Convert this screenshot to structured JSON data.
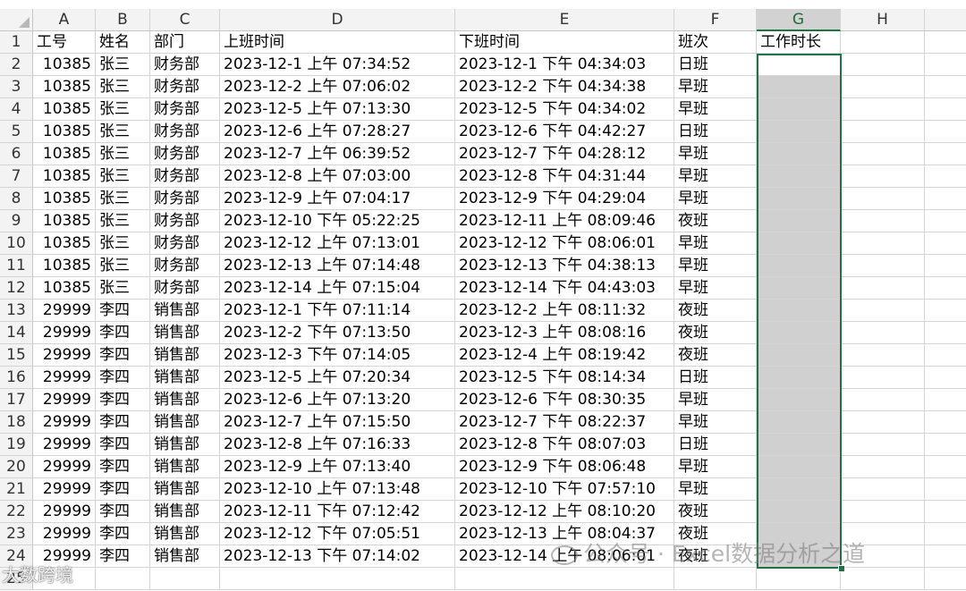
{
  "columns": [
    "A",
    "B",
    "C",
    "D",
    "E",
    "F",
    "G",
    "H"
  ],
  "selected_column": "G",
  "header_row": {
    "row_number": "1",
    "cells": [
      "工号",
      "姓名",
      "部门",
      "上班时间",
      "下班时间",
      "班次",
      "工作时长",
      ""
    ]
  },
  "rows": [
    {
      "n": "2",
      "id": "10385",
      "name": "张三",
      "dept": "财务部",
      "start": "2023-12-1 上午 07:34:52",
      "end": "2023-12-1 下午 04:34:03",
      "shift": "日班"
    },
    {
      "n": "3",
      "id": "10385",
      "name": "张三",
      "dept": "财务部",
      "start": "2023-12-2 上午 07:06:02",
      "end": "2023-12-2 下午 04:34:38",
      "shift": "早班"
    },
    {
      "n": "4",
      "id": "10385",
      "name": "张三",
      "dept": "财务部",
      "start": "2023-12-5 上午 07:13:30",
      "end": "2023-12-5 下午 04:34:02",
      "shift": "早班"
    },
    {
      "n": "5",
      "id": "10385",
      "name": "张三",
      "dept": "财务部",
      "start": "2023-12-6 上午 07:28:27",
      "end": "2023-12-6 下午 04:42:27",
      "shift": "日班"
    },
    {
      "n": "6",
      "id": "10385",
      "name": "张三",
      "dept": "财务部",
      "start": "2023-12-7 上午 06:39:52",
      "end": "2023-12-7 下午 04:28:12",
      "shift": "早班"
    },
    {
      "n": "7",
      "id": "10385",
      "name": "张三",
      "dept": "财务部",
      "start": "2023-12-8 上午 07:03:00",
      "end": "2023-12-8 下午 04:31:44",
      "shift": "早班"
    },
    {
      "n": "8",
      "id": "10385",
      "name": "张三",
      "dept": "财务部",
      "start": "2023-12-9 上午 07:04:17",
      "end": "2023-12-9 下午 04:29:04",
      "shift": "早班"
    },
    {
      "n": "9",
      "id": "10385",
      "name": "张三",
      "dept": "财务部",
      "start": "2023-12-10 下午 05:22:25",
      "end": "2023-12-11 上午 08:09:46",
      "shift": "夜班"
    },
    {
      "n": "10",
      "id": "10385",
      "name": "张三",
      "dept": "财务部",
      "start": "2023-12-12 上午 07:13:01",
      "end": "2023-12-12 下午 08:06:01",
      "shift": "早班"
    },
    {
      "n": "11",
      "id": "10385",
      "name": "张三",
      "dept": "财务部",
      "start": "2023-12-13 上午 07:14:48",
      "end": "2023-12-13 下午 04:38:13",
      "shift": "早班"
    },
    {
      "n": "12",
      "id": "10385",
      "name": "张三",
      "dept": "财务部",
      "start": "2023-12-14 上午 07:15:04",
      "end": "2023-12-14 下午 04:43:03",
      "shift": "早班"
    },
    {
      "n": "13",
      "id": "29999",
      "name": "李四",
      "dept": "销售部",
      "start": "2023-12-1 下午 07:11:14",
      "end": "2023-12-2 上午 08:11:32",
      "shift": "夜班"
    },
    {
      "n": "14",
      "id": "29999",
      "name": "李四",
      "dept": "销售部",
      "start": "2023-12-2 下午 07:13:50",
      "end": "2023-12-3 上午 08:08:16",
      "shift": "夜班"
    },
    {
      "n": "15",
      "id": "29999",
      "name": "李四",
      "dept": "销售部",
      "start": "2023-12-3 下午 07:14:05",
      "end": "2023-12-4 上午 08:19:42",
      "shift": "夜班"
    },
    {
      "n": "16",
      "id": "29999",
      "name": "李四",
      "dept": "销售部",
      "start": "2023-12-5 上午 07:20:34",
      "end": "2023-12-5 下午 08:14:34",
      "shift": "日班"
    },
    {
      "n": "17",
      "id": "29999",
      "name": "李四",
      "dept": "销售部",
      "start": "2023-12-6 上午 07:13:20",
      "end": "2023-12-6 下午 08:30:35",
      "shift": "早班"
    },
    {
      "n": "18",
      "id": "29999",
      "name": "李四",
      "dept": "销售部",
      "start": "2023-12-7 上午 07:15:50",
      "end": "2023-12-7 下午 08:22:37",
      "shift": "早班"
    },
    {
      "n": "19",
      "id": "29999",
      "name": "李四",
      "dept": "销售部",
      "start": "2023-12-8 上午 07:16:33",
      "end": "2023-12-8 下午 08:07:03",
      "shift": "日班"
    },
    {
      "n": "20",
      "id": "29999",
      "name": "李四",
      "dept": "销售部",
      "start": "2023-12-9 上午 07:13:40",
      "end": "2023-12-9 下午 08:06:48",
      "shift": "早班"
    },
    {
      "n": "21",
      "id": "29999",
      "name": "李四",
      "dept": "销售部",
      "start": "2023-12-10 上午 07:13:48",
      "end": "2023-12-10 下午 07:57:10",
      "shift": "早班"
    },
    {
      "n": "22",
      "id": "29999",
      "name": "李四",
      "dept": "销售部",
      "start": "2023-12-11 下午 07:12:42",
      "end": "2023-12-12 上午 08:10:20",
      "shift": "夜班"
    },
    {
      "n": "23",
      "id": "29999",
      "name": "李四",
      "dept": "销售部",
      "start": "2023-12-12 下午 07:05:51",
      "end": "2023-12-13 上午 08:04:37",
      "shift": "夜班"
    },
    {
      "n": "24",
      "id": "29999",
      "name": "李四",
      "dept": "销售部",
      "start": "2023-12-13 下午 07:14:02",
      "end": "2023-12-14 上午 08:06:01",
      "shift": "夜班"
    }
  ],
  "last_row_number": "25",
  "watermarks": {
    "right": "公众号 · Excel数据分析之道",
    "left": "大数跨境"
  },
  "colors": {
    "selection": "#217346",
    "selected_fill": "#d0d0d0",
    "header_bg": "#f3f3f3"
  }
}
